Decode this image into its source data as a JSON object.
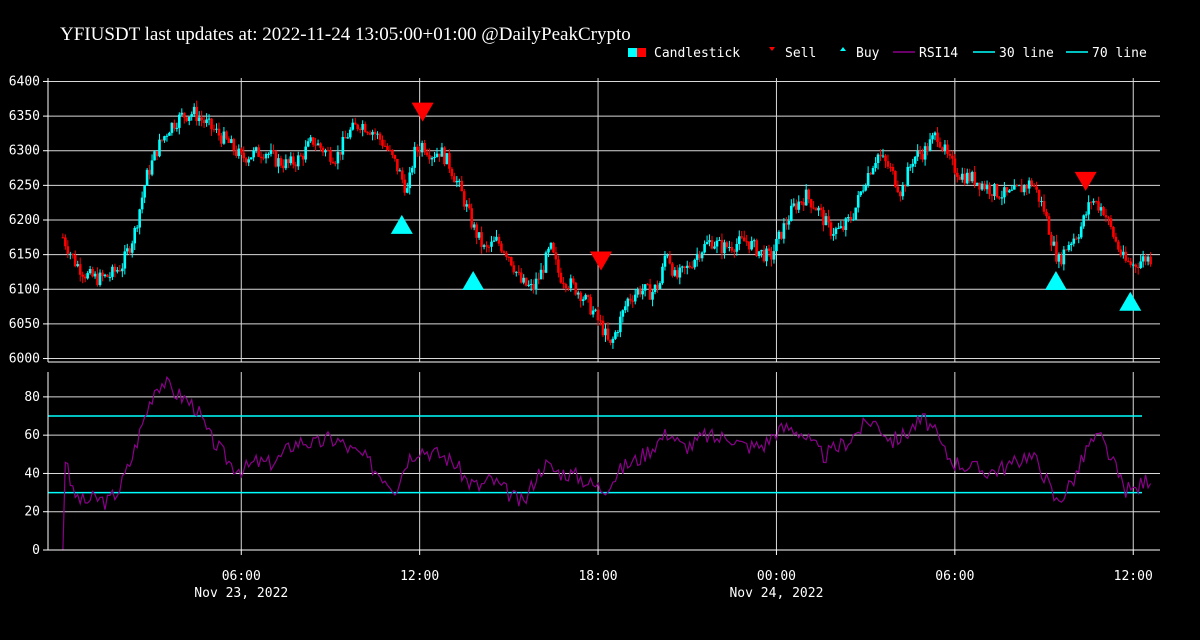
{
  "chart_data": [
    {
      "panel": "price",
      "type": "candlestick",
      "title": "YFIUSDT last updates at: 2022-11-24 13:05:00+01:00 @DailyPeakCrypto",
      "legend": [
        {
          "label": "Candlestick",
          "color": "#00ffff",
          "color2": "#ff0000",
          "marker": "candle"
        },
        {
          "label": "Sell",
          "color": "#ff0000",
          "marker": "tri-down"
        },
        {
          "label": "Buy",
          "color": "#00ffff",
          "marker": "tri-up"
        },
        {
          "label": "RSI14",
          "color": "#8b008b",
          "marker": "line"
        },
        {
          "label": "30 line",
          "color": "#00ffff",
          "marker": "line"
        },
        {
          "label": "70 line",
          "color": "#00ffff",
          "marker": "line"
        }
      ],
      "x_range_hours": [
        -3.6,
        12.6
      ],
      "x_ticks": [
        {
          "h": -18,
          "label": "06:00",
          "sublabel": "Nov 23, 2022"
        },
        {
          "h": -12,
          "label": "12:00",
          "sublabel": ""
        },
        {
          "h": -6,
          "label": "18:00",
          "sublabel": ""
        },
        {
          "h": 0,
          "label": "00:00",
          "sublabel": "Nov 24, 2022"
        },
        {
          "h": 6,
          "label": "06:00",
          "sublabel": ""
        },
        {
          "h": 12,
          "label": "12:00",
          "sublabel": ""
        }
      ],
      "x_anchor_note": "x in hours relative to 2022-11-24 00:00",
      "ylim": [
        5995,
        6405
      ],
      "y_ticks": [
        6000,
        6050,
        6100,
        6150,
        6200,
        6250,
        6300,
        6350,
        6400
      ],
      "close_path": [
        [
          -24.0,
          6175
        ],
        [
          -23.6,
          6140
        ],
        [
          -23.2,
          6120
        ],
        [
          -22.8,
          6115
        ],
        [
          -22.4,
          6120
        ],
        [
          -22.0,
          6135
        ],
        [
          -21.6,
          6180
        ],
        [
          -21.2,
          6260
        ],
        [
          -20.8,
          6305
        ],
        [
          -20.4,
          6335
        ],
        [
          -20.0,
          6350
        ],
        [
          -19.6,
          6355
        ],
        [
          -19.2,
          6340
        ],
        [
          -18.8,
          6325
        ],
        [
          -18.4,
          6310
        ],
        [
          -18.0,
          6290
        ],
        [
          -17.6,
          6295
        ],
        [
          -17.2,
          6300
        ],
        [
          -16.8,
          6285
        ],
        [
          -16.4,
          6280
        ],
        [
          -16.0,
          6290
        ],
        [
          -15.6,
          6315
        ],
        [
          -15.2,
          6300
        ],
        [
          -14.8,
          6290
        ],
        [
          -14.4,
          6325
        ],
        [
          -14.0,
          6340
        ],
        [
          -13.6,
          6330
        ],
        [
          -13.2,
          6310
        ],
        [
          -12.8,
          6280
        ],
        [
          -12.4,
          6240
        ],
        [
          -12.2,
          6295
        ],
        [
          -11.9,
          6310
        ],
        [
          -11.6,
          6295
        ],
        [
          -11.3,
          6300
        ],
        [
          -11.0,
          6280
        ],
        [
          -10.6,
          6240
        ],
        [
          -10.2,
          6190
        ],
        [
          -9.8,
          6155
        ],
        [
          -9.4,
          6170
        ],
        [
          -9.0,
          6150
        ],
        [
          -8.6,
          6110
        ],
        [
          -8.2,
          6100
        ],
        [
          -7.9,
          6125
        ],
        [
          -7.6,
          6160
        ],
        [
          -7.3,
          6120
        ],
        [
          -7.0,
          6110
        ],
        [
          -6.6,
          6095
        ],
        [
          -6.2,
          6070
        ],
        [
          -5.8,
          6040
        ],
        [
          -5.6,
          6015
        ],
        [
          -5.3,
          6050
        ],
        [
          -5.0,
          6085
        ],
        [
          -4.6,
          6100
        ],
        [
          -4.2,
          6095
        ],
        [
          -3.9,
          6110
        ],
        [
          -3.7,
          6160
        ],
        [
          -3.4,
          6115
        ],
        [
          -3.0,
          6130
        ],
        [
          -2.6,
          6155
        ],
        [
          -2.2,
          6170
        ],
        [
          -1.8,
          6160
        ],
        [
          -1.4,
          6165
        ],
        [
          -1.0,
          6170
        ],
        [
          -0.6,
          6155
        ],
        [
          -0.2,
          6145
        ],
        [
          0.2,
          6185
        ],
        [
          0.6,
          6220
        ],
        [
          1.0,
          6235
        ],
        [
          1.4,
          6215
        ],
        [
          1.8,
          6185
        ],
        [
          2.2,
          6185
        ],
        [
          2.6,
          6210
        ],
        [
          3.0,
          6260
        ],
        [
          3.4,
          6295
        ],
        [
          3.8,
          6275
        ],
        [
          4.2,
          6240
        ],
        [
          4.6,
          6290
        ],
        [
          5.0,
          6300
        ],
        [
          5.4,
          6325
        ],
        [
          5.8,
          6285
        ],
        [
          6.2,
          6265
        ],
        [
          6.6,
          6260
        ],
        [
          7.0,
          6250
        ],
        [
          7.4,
          6240
        ],
        [
          7.8,
          6235
        ],
        [
          8.2,
          6245
        ],
        [
          8.6,
          6255
        ],
        [
          9.0,
          6215
        ],
        [
          9.3,
          6165
        ],
        [
          9.5,
          6140
        ],
        [
          9.8,
          6165
        ],
        [
          10.2,
          6185
        ],
        [
          10.6,
          6230
        ],
        [
          11.0,
          6215
        ],
        [
          11.4,
          6170
        ],
        [
          11.7,
          6140
        ],
        [
          12.0,
          6135
        ],
        [
          12.4,
          6145
        ],
        [
          12.6,
          6145
        ]
      ],
      "sell_signals": [
        [
          -11.9,
          6355
        ],
        [
          -5.9,
          6140
        ],
        [
          10.4,
          6255
        ]
      ],
      "buy_signals": [
        [
          -12.6,
          6193
        ],
        [
          -10.2,
          6112
        ],
        [
          9.4,
          6112
        ],
        [
          11.9,
          6082
        ]
      ]
    },
    {
      "panel": "rsi",
      "type": "line",
      "series": [
        {
          "name": "RSI14",
          "color": "#8b008b"
        }
      ],
      "ylim": [
        0,
        93
      ],
      "y_ticks": [
        0,
        20,
        40,
        60,
        80
      ],
      "ref_lines": [
        {
          "value": 30,
          "color": "#00ffff"
        },
        {
          "value": 70,
          "color": "#00ffff"
        }
      ],
      "rsi_path": [
        [
          -24.0,
          0
        ],
        [
          -23.9,
          55
        ],
        [
          -23.7,
          30
        ],
        [
          -23.3,
          25
        ],
        [
          -22.9,
          27
        ],
        [
          -22.5,
          25
        ],
        [
          -22.1,
          32
        ],
        [
          -21.7,
          47
        ],
        [
          -21.3,
          67
        ],
        [
          -20.9,
          85
        ],
        [
          -20.6,
          88
        ],
        [
          -20.3,
          83
        ],
        [
          -19.9,
          79
        ],
        [
          -19.5,
          74
        ],
        [
          -19.1,
          60
        ],
        [
          -18.7,
          52
        ],
        [
          -18.3,
          44
        ],
        [
          -17.9,
          42
        ],
        [
          -17.5,
          46
        ],
        [
          -17.1,
          45
        ],
        [
          -16.7,
          48
        ],
        [
          -16.3,
          55
        ],
        [
          -15.9,
          57
        ],
        [
          -15.5,
          55
        ],
        [
          -15.1,
          58
        ],
        [
          -14.7,
          57
        ],
        [
          -14.3,
          52
        ],
        [
          -13.9,
          49
        ],
        [
          -13.5,
          42
        ],
        [
          -13.1,
          37
        ],
        [
          -12.8,
          32
        ],
        [
          -12.4,
          48
        ],
        [
          -12.0,
          53
        ],
        [
          -11.6,
          51
        ],
        [
          -11.2,
          49
        ],
        [
          -10.8,
          45
        ],
        [
          -10.4,
          36
        ],
        [
          -10.0,
          33
        ],
        [
          -9.6,
          37
        ],
        [
          -9.2,
          32
        ],
        [
          -8.8,
          27
        ],
        [
          -8.5,
          24
        ],
        [
          -8.1,
          38
        ],
        [
          -7.8,
          45
        ],
        [
          -7.4,
          41
        ],
        [
          -7.0,
          40
        ],
        [
          -6.6,
          38
        ],
        [
          -6.2,
          34
        ],
        [
          -5.8,
          32
        ],
        [
          -5.5,
          37
        ],
        [
          -5.1,
          44
        ],
        [
          -4.7,
          47
        ],
        [
          -4.3,
          52
        ],
        [
          -3.9,
          58
        ],
        [
          -3.6,
          62
        ],
        [
          -3.2,
          54
        ],
        [
          -2.8,
          55
        ],
        [
          -2.4,
          60
        ],
        [
          -2.0,
          58
        ],
        [
          -1.6,
          60
        ],
        [
          -1.2,
          55
        ],
        [
          -0.8,
          54
        ],
        [
          -0.4,
          55
        ],
        [
          0.0,
          62
        ],
        [
          0.4,
          64
        ],
        [
          0.8,
          62
        ],
        [
          1.2,
          55
        ],
        [
          1.6,
          49
        ],
        [
          2.0,
          53
        ],
        [
          2.4,
          57
        ],
        [
          2.8,
          63
        ],
        [
          3.2,
          68
        ],
        [
          3.5,
          64
        ],
        [
          3.9,
          57
        ],
        [
          4.3,
          60
        ],
        [
          4.7,
          66
        ],
        [
          5.0,
          68
        ],
        [
          5.3,
          62
        ],
        [
          5.7,
          50
        ],
        [
          6.0,
          46
        ],
        [
          6.4,
          44
        ],
        [
          6.8,
          42
        ],
        [
          7.2,
          41
        ],
        [
          7.6,
          43
        ],
        [
          8.0,
          45
        ],
        [
          8.4,
          50
        ],
        [
          8.8,
          46
        ],
        [
          9.1,
          36
        ],
        [
          9.4,
          25
        ],
        [
          9.7,
          30
        ],
        [
          10.1,
          40
        ],
        [
          10.5,
          55
        ],
        [
          10.9,
          59
        ],
        [
          11.3,
          46
        ],
        [
          11.7,
          32
        ],
        [
          12.0,
          31
        ],
        [
          12.4,
          36
        ],
        [
          12.6,
          38
        ]
      ]
    }
  ]
}
